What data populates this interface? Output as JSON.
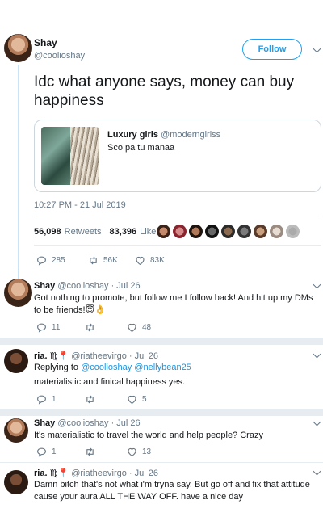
{
  "main_tweet": {
    "name": "Shay",
    "handle": "@coolioshay",
    "follow_label": "Follow",
    "text": "Idc what anyone says, money can buy happiness",
    "quote": {
      "name": "Luxury girls",
      "handle": "@moderngirlss",
      "text": "Sco pa tu manaa"
    },
    "timestamp": "10:27 PM - 21 Jul 2019",
    "retweets_count": "56,098",
    "retweets_label": "Retweets",
    "likes_count": "83,396",
    "likes_label": "Likes",
    "replies_action": "285",
    "retweets_action": "56K",
    "likes_action": "83K"
  },
  "replies": [
    {
      "name": "Shay",
      "handle": "@coolioshay",
      "date": "· Jul 26",
      "text": "Got nothing to promote, but follow me I follow back! And hit up my DMs to be friends!",
      "emojis": "😇👌",
      "reply_count": "11",
      "retweet_count": "",
      "like_count": "48"
    },
    {
      "name": "ria.",
      "name_emojis": "♍📍",
      "handle": "@riatheevirgo",
      "date": "· Jul 26",
      "replying_prefix": "Replying to",
      "replying_to": "@coolioshay @nellybean25",
      "text": "materialistic and finical happiness yes.",
      "reply_count": "1",
      "retweet_count": "",
      "like_count": "5"
    },
    {
      "name": "Shay",
      "handle": "@coolioshay",
      "date": "· Jul 26",
      "text": "It's materialistic to travel the world and help people? Crazy",
      "reply_count": "1",
      "retweet_count": "",
      "like_count": "13"
    },
    {
      "name": "ria.",
      "name_emojis": "♍📍",
      "handle": "@riatheevirgo",
      "date": "· Jul 26",
      "text": "Damn bitch that's not what i'm tryna say. But go off and fix that attitude cause your aura ALL THE WAY OFF. have a nice day"
    }
  ],
  "colors": {
    "accent": "#1da1f2",
    "link": "#1b95e0",
    "muted": "#657786",
    "thread_line": "#c9e4f6"
  },
  "icons": [
    "reply-icon",
    "retweet-icon",
    "like-icon",
    "chevron-down-icon"
  ]
}
